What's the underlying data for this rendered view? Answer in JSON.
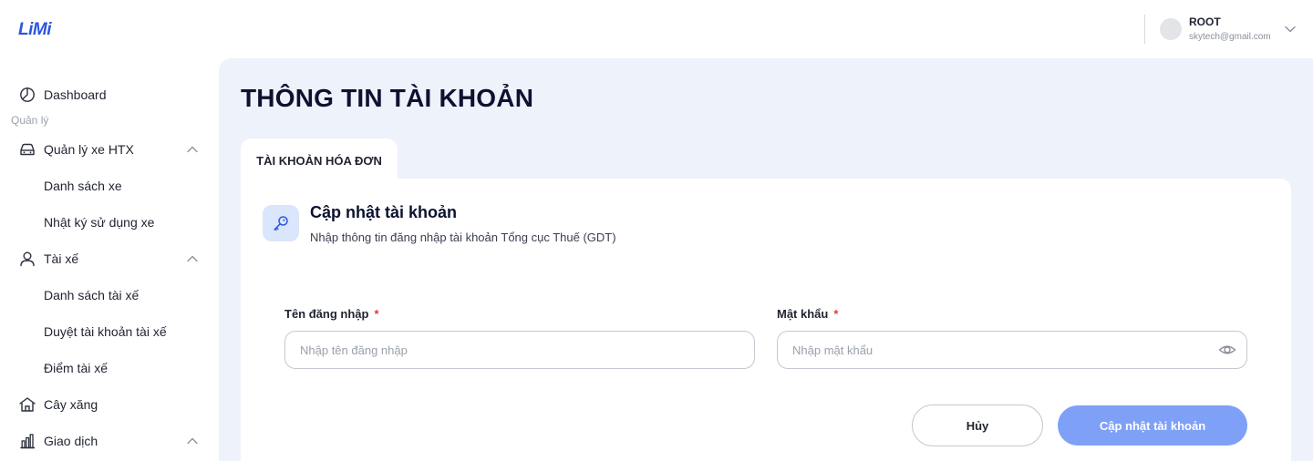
{
  "header": {
    "logo_prefix": "Li",
    "logo_suffix": "Mi",
    "user_name": "ROOT",
    "user_email": "skytech@gmail.com"
  },
  "sidebar": {
    "section_label": "Quản lý",
    "items": [
      {
        "label": "Dashboard",
        "icon": "dashboard-icon"
      },
      {
        "label": "Quản lý xe HTX",
        "icon": "car-icon",
        "expanded": true
      },
      {
        "label": "Danh sách xe"
      },
      {
        "label": "Nhật ký sử dụng xe"
      },
      {
        "label": "Tài xế",
        "icon": "user-icon",
        "expanded": true
      },
      {
        "label": "Danh sách tài xế"
      },
      {
        "label": "Duyệt tài khoản tài xế"
      },
      {
        "label": "Điểm tài xế"
      },
      {
        "label": "Cây xăng",
        "icon": "home-icon"
      },
      {
        "label": "Giao dịch",
        "icon": "bar-chart-icon",
        "expanded": true
      }
    ]
  },
  "main": {
    "title": "THÔNG TIN TÀI KHOẢN",
    "tab_label": "TÀI KHOẢN HÓA ĐƠN",
    "card": {
      "icon": "key-icon",
      "title": "Cập nhật tài khoản",
      "subtitle": "Nhập thông tin đăng nhập tài khoản Tổng cục Thuế (GDT)"
    },
    "form": {
      "username_label": "Tên đăng nhập",
      "username_placeholder": "Nhập tên đăng nhập",
      "username_value": "",
      "password_label": "Mật khẩu",
      "password_placeholder": "Nhập mật khẩu",
      "password_value": "",
      "required_mark": "*"
    },
    "actions": {
      "cancel_label": "Hủy",
      "submit_label": "Cập nhật tài khoản"
    }
  },
  "colors": {
    "brand": "#2b55e0",
    "primary_button": "#7ea0f7",
    "required": "#e53935",
    "main_background": "#eef2fa"
  }
}
